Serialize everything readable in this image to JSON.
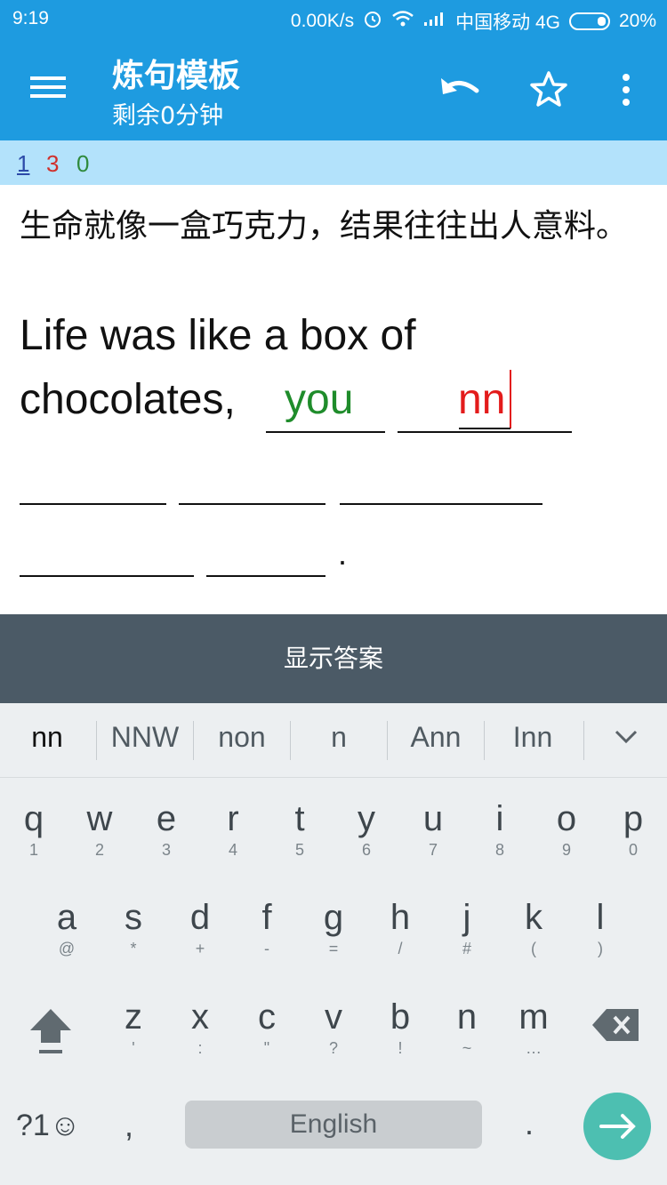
{
  "status_bar": {
    "time": "9:19",
    "network_speed": "0.00K/s",
    "carrier": "中国移动 4G",
    "battery": "20%"
  },
  "app_bar": {
    "title": "炼句模板",
    "subtitle": "剩余0分钟",
    "icons": [
      "menu-icon",
      "undo-icon",
      "star-icon",
      "more-vert-icon"
    ]
  },
  "counters": {
    "current": "1",
    "wrong": "3",
    "correct": "0"
  },
  "exercise": {
    "chinese": "生命就像一盒巧克力，结果往往出人意料。",
    "english_line1": "Life was like a box of",
    "english_line2_prefix": "chocolates,",
    "answer_correct": "you",
    "answer_typing": "nn",
    "end_punct": "."
  },
  "show_answer_label": "显示答案",
  "keyboard": {
    "suggestions": [
      "nn",
      "NNW",
      "non",
      "n",
      "Ann",
      "Inn"
    ],
    "row1": [
      {
        "k": "q",
        "s": "1"
      },
      {
        "k": "w",
        "s": "2"
      },
      {
        "k": "e",
        "s": "3"
      },
      {
        "k": "r",
        "s": "4"
      },
      {
        "k": "t",
        "s": "5"
      },
      {
        "k": "y",
        "s": "6"
      },
      {
        "k": "u",
        "s": "7"
      },
      {
        "k": "i",
        "s": "8"
      },
      {
        "k": "o",
        "s": "9"
      },
      {
        "k": "p",
        "s": "0"
      }
    ],
    "row2": [
      {
        "k": "a",
        "s": "@"
      },
      {
        "k": "s",
        "s": "*"
      },
      {
        "k": "d",
        "s": "+"
      },
      {
        "k": "f",
        "s": "-"
      },
      {
        "k": "g",
        "s": "="
      },
      {
        "k": "h",
        "s": "/"
      },
      {
        "k": "j",
        "s": "#"
      },
      {
        "k": "k",
        "s": "("
      },
      {
        "k": "l",
        "s": ")"
      }
    ],
    "row3": [
      {
        "k": "z",
        "s": "'"
      },
      {
        "k": "x",
        "s": ":"
      },
      {
        "k": "c",
        "s": "\""
      },
      {
        "k": "v",
        "s": "?"
      },
      {
        "k": "b",
        "s": "!"
      },
      {
        "k": "n",
        "s": "~"
      },
      {
        "k": "m",
        "s": "…"
      }
    ],
    "symbols_label": "?1☺",
    "comma": ",",
    "space_label": "English",
    "period": "."
  },
  "colors": {
    "app_bar": "#1e9be0",
    "counters_bg": "#b3e2fb",
    "answer_bar": "#4b5a66",
    "correct_text": "#1f8c2b",
    "typing_text": "#e31b1b",
    "enter_key": "#4dbfb1"
  }
}
